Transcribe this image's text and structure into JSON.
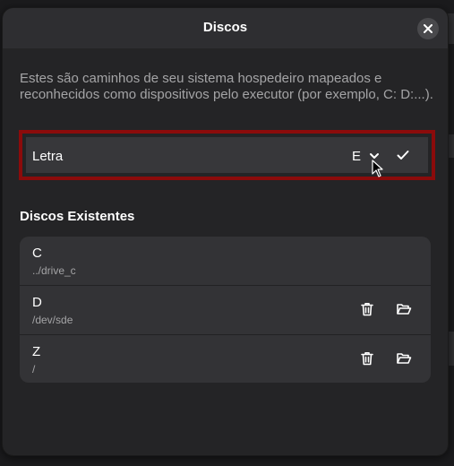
{
  "dialog": {
    "title": "Discos",
    "close_icon": "close-icon",
    "description": "Estes são caminhos de seu sistema hospedeiro mapeados e reconhecidos como dispositivos pelo executor (por exemplo, C: D:...).",
    "new_drive": {
      "label": "Letra",
      "selected_letter": "E",
      "dropdown_icon": "chevron-down-icon",
      "confirm_icon": "checkmark-icon"
    },
    "section_title": "Discos Existentes",
    "drives": [
      {
        "letter": "C",
        "path": "../drive_c",
        "removable": false
      },
      {
        "letter": "D",
        "path": "/dev/sde",
        "removable": true
      },
      {
        "letter": "Z",
        "path": "/",
        "removable": true
      }
    ],
    "row_icons": {
      "delete": "trash-icon",
      "browse": "folder-open-icon"
    }
  },
  "colors": {
    "highlight_border": "#8b0b0b",
    "dialog_bg": "#242426",
    "header_bg": "#2e2e31",
    "list_bg": "#333336"
  }
}
